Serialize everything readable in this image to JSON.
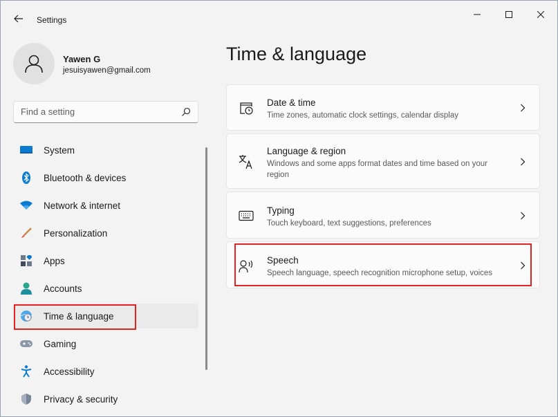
{
  "window": {
    "title": "Settings"
  },
  "profile": {
    "name": "Yawen G",
    "email": "jesuisyawen@gmail.com"
  },
  "search": {
    "placeholder": "Find a setting"
  },
  "sidebar": {
    "items": [
      {
        "label": "System",
        "icon": "system-icon",
        "active": false
      },
      {
        "label": "Bluetooth & devices",
        "icon": "bluetooth-icon",
        "active": false
      },
      {
        "label": "Network & internet",
        "icon": "wifi-icon",
        "active": false
      },
      {
        "label": "Personalization",
        "icon": "brush-icon",
        "active": false
      },
      {
        "label": "Apps",
        "icon": "apps-icon",
        "active": false
      },
      {
        "label": "Accounts",
        "icon": "accounts-icon",
        "active": false
      },
      {
        "label": "Time & language",
        "icon": "time-language-icon",
        "active": true
      },
      {
        "label": "Gaming",
        "icon": "gamepad-icon",
        "active": false
      },
      {
        "label": "Accessibility",
        "icon": "accessibility-icon",
        "active": false
      },
      {
        "label": "Privacy & security",
        "icon": "shield-icon",
        "active": false
      }
    ]
  },
  "main": {
    "title": "Time & language",
    "cards": [
      {
        "title": "Date & time",
        "description": "Time zones, automatic clock settings, calendar display",
        "icon": "calendar-clock-icon"
      },
      {
        "title": "Language & region",
        "description": "Windows and some apps format dates and time based on your region",
        "icon": "language-icon"
      },
      {
        "title": "Typing",
        "description": "Touch keyboard, text suggestions, preferences",
        "icon": "keyboard-icon"
      },
      {
        "title": "Speech",
        "description": "Speech language, speech recognition microphone setup, voices",
        "icon": "speech-icon"
      }
    ]
  },
  "colors": {
    "accent": "#0067c0",
    "highlight": "#e52222",
    "background": "#f3f3f3"
  }
}
